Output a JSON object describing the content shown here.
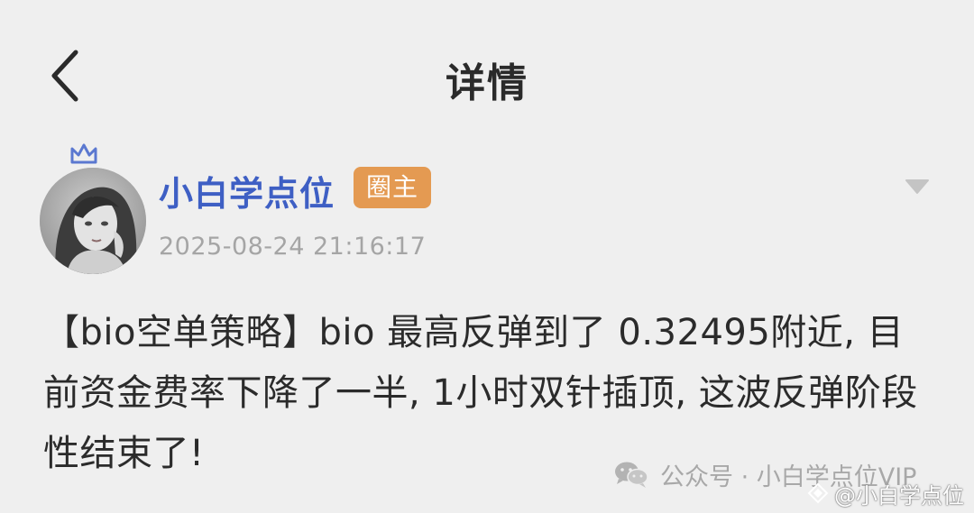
{
  "header": {
    "title": "详情",
    "back_icon": "chevron-left-icon"
  },
  "post": {
    "author": {
      "name": "小白学点位",
      "badge": "圈主",
      "badge_color": "#e49a52",
      "name_color": "#3e5fc4",
      "crown_icon": "crown-icon"
    },
    "timestamp": "2025-08-24 21:16:17",
    "more_icon": "caret-down-icon",
    "content": "【bio空单策略】bio 最高反弹到了 0.32495附近, 目前资金费率下降了一半, 1小时双针插顶, 这波反弹阶段性结束了!"
  },
  "watermark": {
    "line1": "公众号 · 小白学点位VIP",
    "line2": "@小白学点位",
    "icon1": "wechat-icon",
    "icon2": "diamond-icon"
  }
}
